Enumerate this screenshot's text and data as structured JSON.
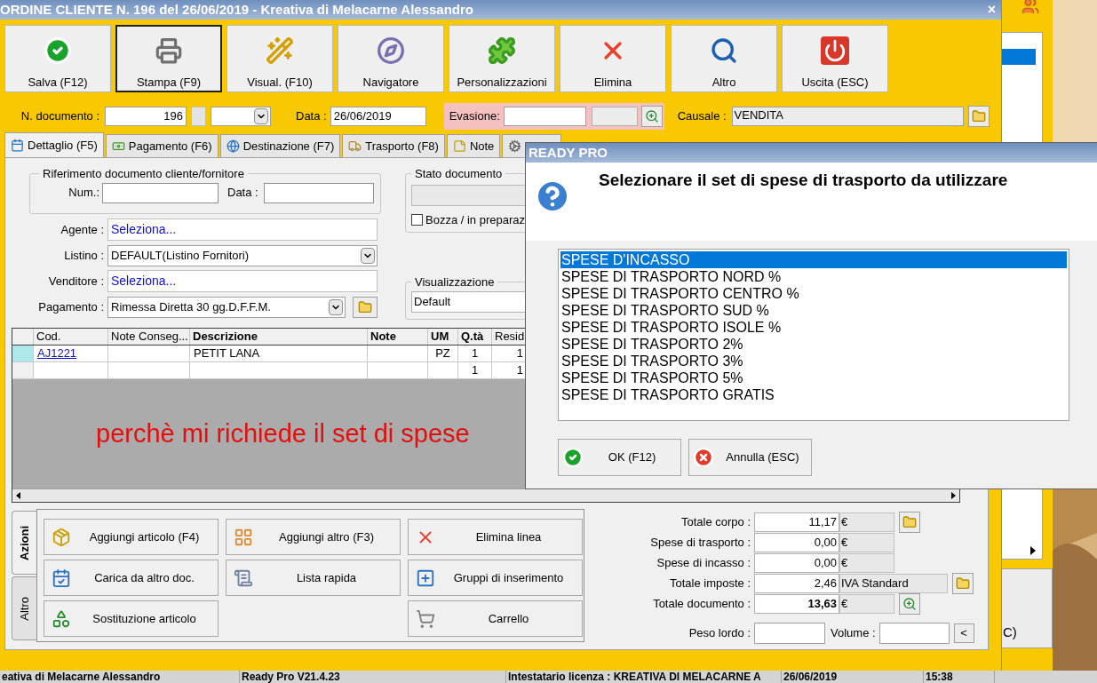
{
  "main_window": {
    "title": "ORDINE CLIENTE N. 196 del 26/06/2019 - Kreativa di Melacarne Alessandro",
    "close": "×"
  },
  "toolbar": [
    {
      "label": "Salva (F12)",
      "focused": false
    },
    {
      "label": "Stampa (F9)",
      "focused": true
    },
    {
      "label": "Visual. (F10)",
      "focused": false
    },
    {
      "label": "Navigatore",
      "focused": false
    },
    {
      "label": "Personalizzazioni",
      "focused": false
    },
    {
      "label": "Elimina",
      "focused": false
    },
    {
      "label": "Altro",
      "focused": false
    },
    {
      "label": "Uscita (ESC)",
      "focused": false
    }
  ],
  "header": {
    "numero_label": "N. documento :",
    "numero": "196",
    "data_label": "Data :",
    "data": "26/06/2019",
    "evasione_label": "Evasione:",
    "causale_label": "Causale :",
    "causale": "VENDITA"
  },
  "tabs": [
    {
      "label": "Dettaglio (F5)",
      "selected": true
    },
    {
      "label": "Pagamento (F6)",
      "selected": false
    },
    {
      "label": "Destinazione (F7)",
      "selected": false
    },
    {
      "label": "Trasporto (F8)",
      "selected": false
    },
    {
      "label": "Note",
      "selected": false
    },
    {
      "selected": false
    }
  ],
  "riferimento": {
    "title": "Riferimento documento cliente/fornitore",
    "num_label": "Num.:",
    "data_label": "Data :"
  },
  "form_rows": [
    {
      "label": "Agente :",
      "value": "Seleziona...",
      "kind": "link"
    },
    {
      "label": "Listino :",
      "value": "DEFAULT(Listino Fornitori)",
      "kind": "dropdown"
    },
    {
      "label": "Venditore :",
      "value": "Seleziona...",
      "kind": "link"
    },
    {
      "label": "Pagamento :",
      "value": "Rimessa Diretta 30 gg.D.F.F.M.",
      "kind": "dropdown_folder"
    }
  ],
  "stato_documento": {
    "title": "Stato documento",
    "checkbox": {
      "label": "Bozza / in preparaz",
      "checked": false
    }
  },
  "visualizzazione": {
    "title": "Visualizzazione",
    "value": "Default"
  },
  "grid": {
    "columns": [
      {
        "label": "Cod.",
        "bold": false
      },
      {
        "label": "Note Conseg...",
        "bold": false
      },
      {
        "label": "Descrizione",
        "bold": true
      },
      {
        "label": "Note",
        "bold": true
      },
      {
        "label": "UM",
        "bold": true
      },
      {
        "label": "Q.tà",
        "bold": true
      },
      {
        "label": "Resid",
        "bold": false
      }
    ],
    "rows": [
      {
        "selected": true,
        "cod": "AJ1221",
        "descrizione": "PETIT LANA",
        "um": "PZ",
        "qta": "1",
        "resid": "1"
      },
      {
        "selected": false,
        "qta": "1",
        "resid": "1"
      }
    ]
  },
  "annotation": "perchè mi richiede il set di spese",
  "action_tabs": [
    {
      "label": "Azioni",
      "selected": true
    },
    {
      "label": "Altro",
      "selected": false
    }
  ],
  "action_columns": [
    [
      "Aggiungi articolo (F4)",
      "Carica da altro doc.",
      "Sostituzione articolo"
    ],
    [
      "Aggiungi altro (F3)",
      "Lista rapida"
    ],
    [
      "Elimina linea",
      "Gruppi di inserimento",
      "Carrello"
    ]
  ],
  "totals": [
    {
      "label": "Totale corpo :",
      "value": "11,17",
      "unit": "€",
      "kind": "folder",
      "bold": false
    },
    {
      "label": "Spese di trasporto :",
      "value": "0,00",
      "unit": "€",
      "kind": "plain",
      "bold": false
    },
    {
      "label": "Spese di incasso :",
      "value": "0,00",
      "unit": "€",
      "kind": "plain",
      "bold": false
    },
    {
      "label": "Totale imposte :",
      "value": "2,46",
      "unit": "IVA Standard",
      "kind": "tax",
      "bold": false
    },
    {
      "label": "Totale documento :",
      "value": "13,63",
      "unit": "€",
      "kind": "zoom",
      "bold": true
    }
  ],
  "peso": {
    "peso_label": "Peso lordo :",
    "volume_label": "Volume :",
    "button": "<"
  },
  "dialog": {
    "title": "READY PRO",
    "message": "Selezionare il set di spese di trasporto da utilizzare",
    "options": [
      {
        "label": "SPESE D'INCASSO",
        "selected": true
      },
      {
        "label": "SPESE DI TRASPORTO NORD %",
        "selected": false
      },
      {
        "label": "SPESE DI TRASPORTO CENTRO %",
        "selected": false
      },
      {
        "label": "SPESE DI TRASPORTO SUD %",
        "selected": false
      },
      {
        "label": "SPESE DI TRASPORTO ISOLE %",
        "selected": false
      },
      {
        "label": "SPESE DI TRASPORTO 2%",
        "selected": false
      },
      {
        "label": "SPESE DI TRASPORTO 3%",
        "selected": false
      },
      {
        "label": "SPESE DI TRASPORTO 5%",
        "selected": false
      },
      {
        "label": "SPESE DI TRASPORTO GRATIS",
        "selected": false
      }
    ],
    "buttons": [
      "OK (F12)",
      "Annulla (ESC)"
    ]
  },
  "background_window": {
    "list_rows": [
      {
        "selected": true
      }
    ],
    "button": "C)"
  },
  "status_bar": [
    "eativa di Melacarne Alessandro",
    "Ready Pro V21.4.23",
    "Intestatario licenza : KREATIVA DI MELACARNE A",
    "26/06/2019",
    "15:38"
  ]
}
